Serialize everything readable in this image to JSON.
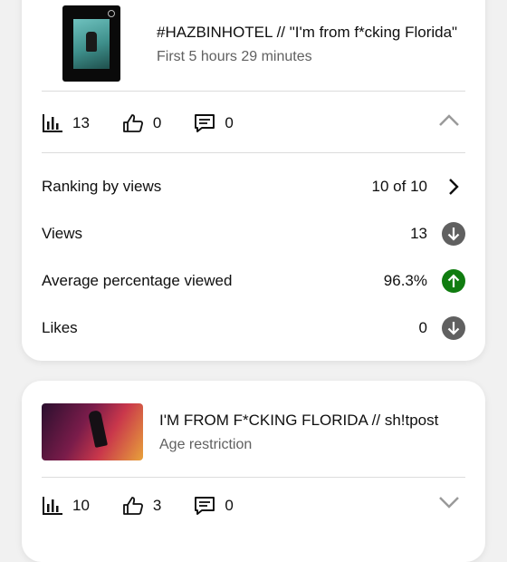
{
  "colors": {
    "trend_down": "#606060",
    "trend_up": "#107c10"
  },
  "videos": [
    {
      "title": "#HAZBINHOTEL // \"I'm from f*cking Florida\"",
      "subtitle": "First 5 hours 29 minutes",
      "stats": {
        "views": "13",
        "likes": "0",
        "comments": "0"
      },
      "expanded": true,
      "metrics": [
        {
          "label": "Ranking by views",
          "value": "10 of 10",
          "icon": "chevron-right-icon"
        },
        {
          "label": "Views",
          "value": "13",
          "icon": "arrow-down-icon"
        },
        {
          "label": "Average percentage viewed",
          "value": "96.3%",
          "icon": "arrow-up-icon"
        },
        {
          "label": "Likes",
          "value": "0",
          "icon": "arrow-down-icon"
        }
      ]
    },
    {
      "title": "I'M FROM F*CKING FLORIDA // sh!tpost",
      "subtitle": "Age restriction",
      "stats": {
        "views": "10",
        "likes": "3",
        "comments": "0"
      },
      "expanded": false
    }
  ]
}
